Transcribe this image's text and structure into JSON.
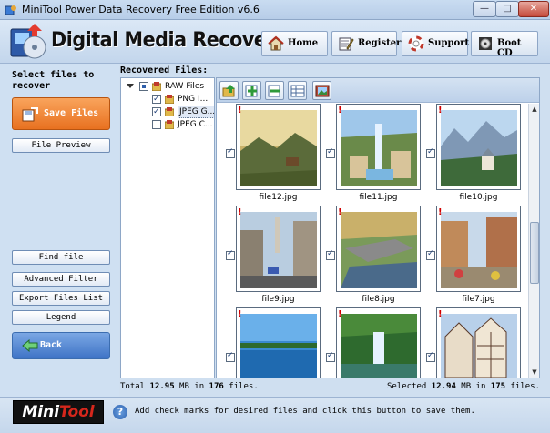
{
  "window": {
    "title": "MiniTool Power Data Recovery Free Edition v6.6",
    "min_label": "—",
    "max_label": "□",
    "close_label": "✕"
  },
  "header": {
    "app_name": "Digital Media Recovery",
    "buttons": {
      "home": "Home",
      "register": "Register",
      "support": "Support",
      "bootcd": "Boot CD"
    }
  },
  "sidebar": {
    "select_label": "Select files to recover",
    "save_files": "Save Files",
    "file_preview": "File Preview",
    "find_file": "Find file",
    "advanced_filter": "Advanced Filter",
    "export_files_list": "Export Files List",
    "legend": "Legend",
    "back": "Back"
  },
  "recovered": {
    "label": "Recovered Files:",
    "tree": [
      {
        "label": "RAW Files",
        "checked": "partial",
        "expanded": true
      },
      {
        "label": "PNG I...",
        "checked": "on"
      },
      {
        "label": "JPEG G...",
        "checked": "on",
        "selected": true
      },
      {
        "label": "JPEG C...",
        "checked": "off"
      }
    ],
    "files": [
      {
        "name": "file12.jpg",
        "checked": true
      },
      {
        "name": "file11.jpg",
        "checked": true
      },
      {
        "name": "file10.jpg",
        "checked": true
      },
      {
        "name": "file9.jpg",
        "checked": true
      },
      {
        "name": "file8.jpg",
        "checked": true
      },
      {
        "name": "file7.jpg",
        "checked": true
      },
      {
        "name": "",
        "checked": true
      },
      {
        "name": "",
        "checked": true
      },
      {
        "name": "",
        "checked": true
      }
    ],
    "scroll_up": "▲",
    "scroll_down": "▼"
  },
  "status": {
    "total_prefix": "Total",
    "total_size": "12.95",
    "total_mid": "MB in",
    "total_count": "176",
    "total_suffix": "files.",
    "selected_prefix": "Selected",
    "selected_size": "12.94",
    "selected_mid": "MB in",
    "selected_count": "175",
    "selected_suffix": "files."
  },
  "footer": {
    "logo_left": "Mini",
    "logo_right": "Tool",
    "help": "?",
    "hint": "Add check marks for desired files and click this button to save them."
  },
  "colors": {
    "save_orange": "#e87120",
    "back_blue": "#3f74c6",
    "warning_red": "#d10000"
  }
}
